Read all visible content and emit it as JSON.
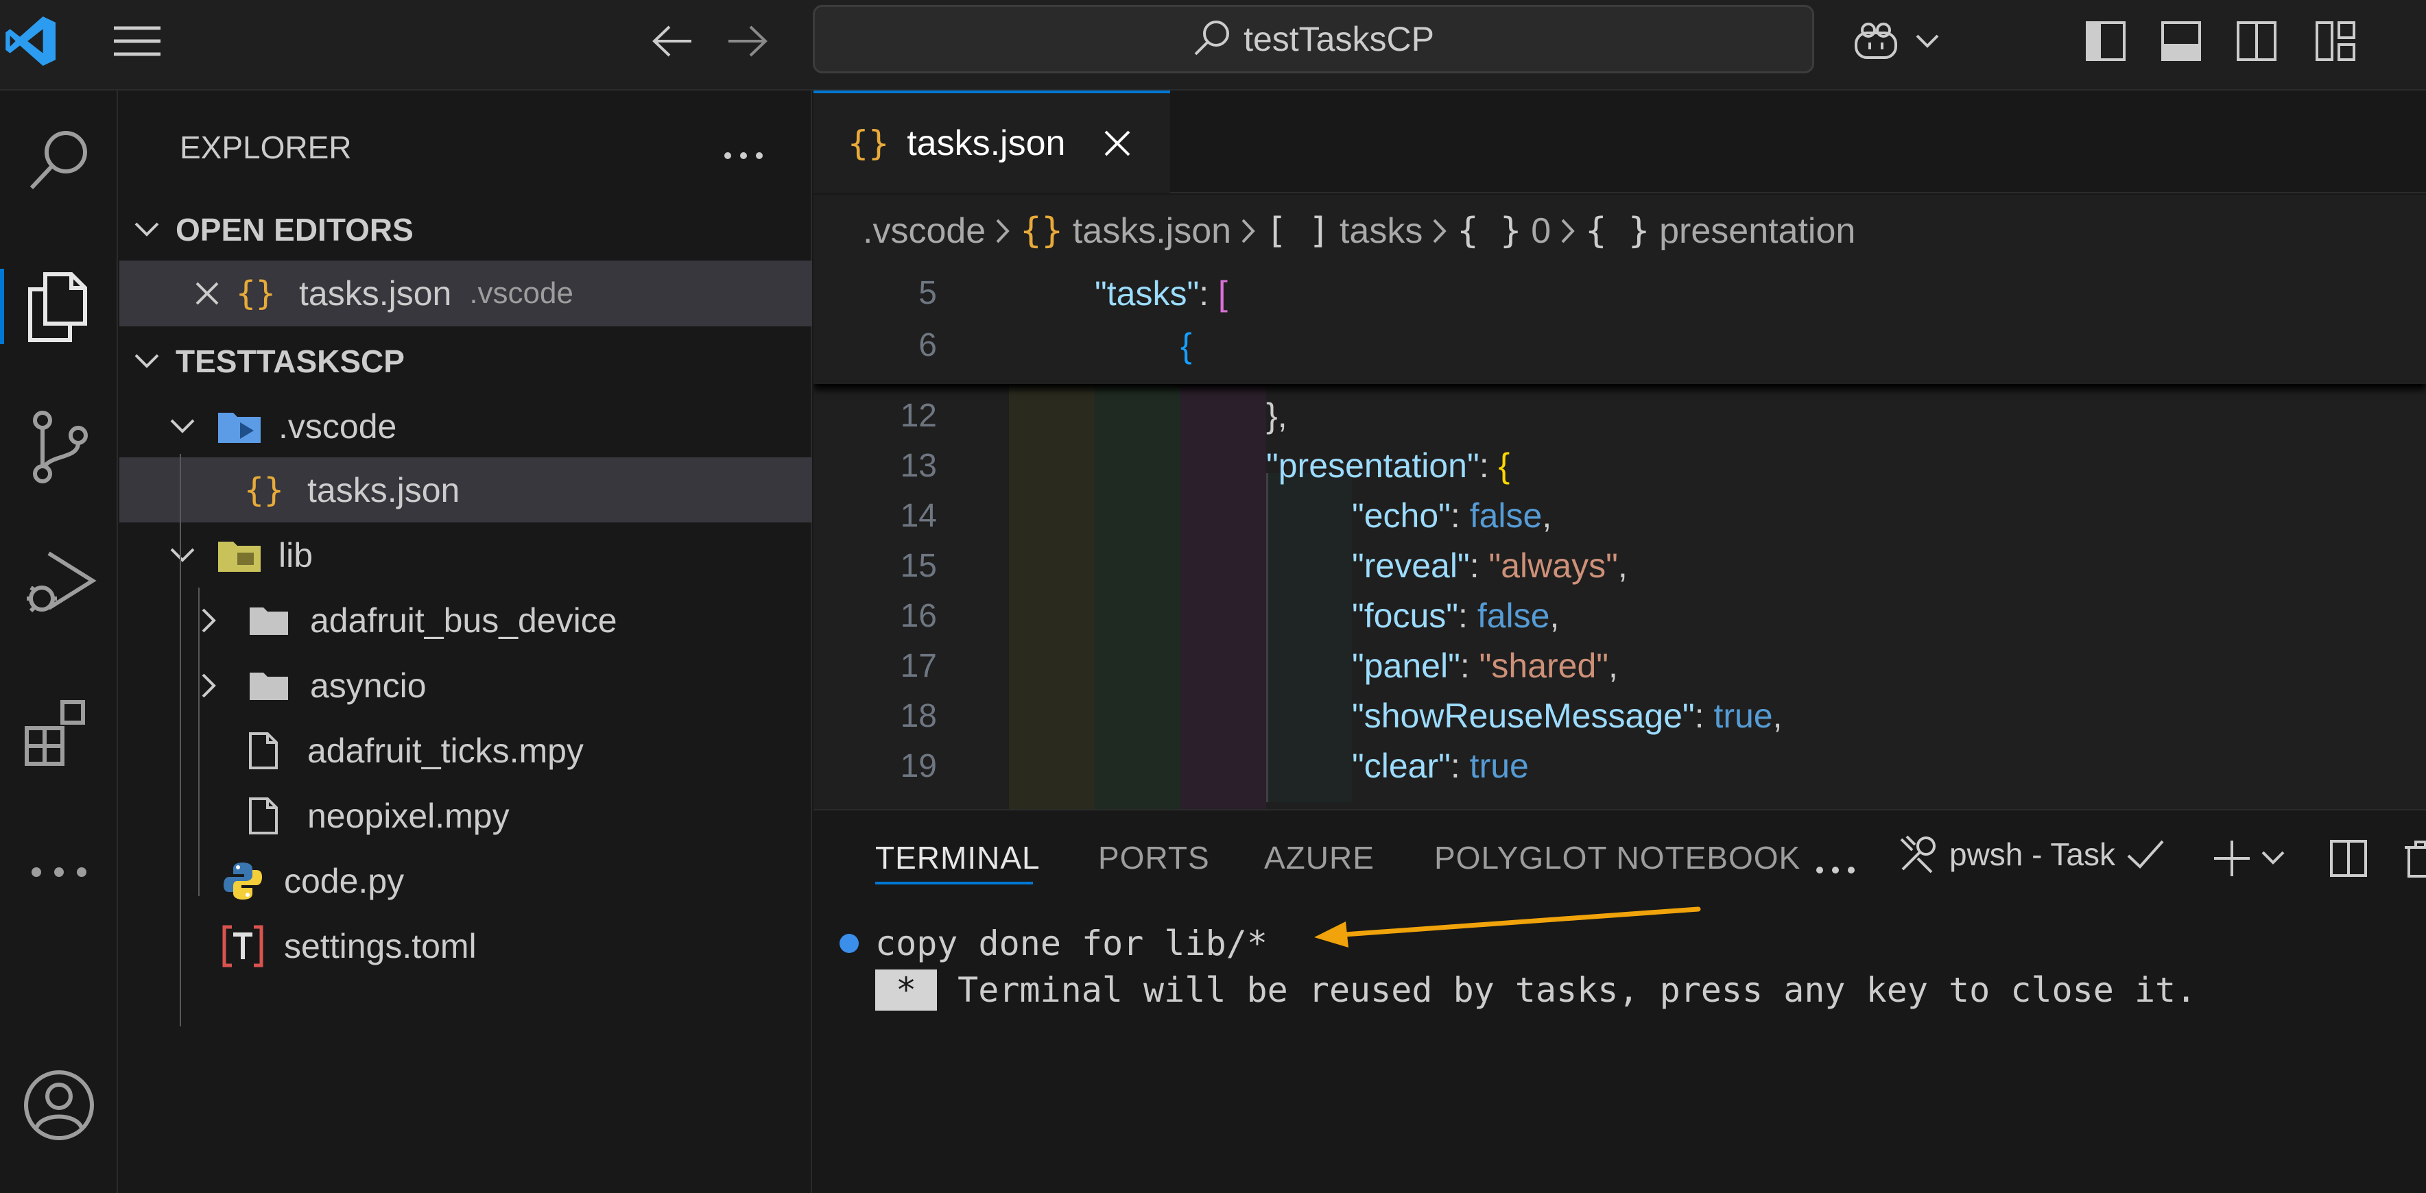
{
  "titlebar": {
    "search_text": "testTasksCP",
    "icons": [
      "vscode-logo-icon",
      "menu-icon",
      "back-arrow-icon",
      "forward-arrow-icon",
      "search-icon",
      "copilot-icon",
      "chevron-down-icon",
      "toggle-primary-sidebar-icon",
      "toggle-panel-icon",
      "toggle-secondary-sidebar-icon",
      "customize-layout-icon"
    ]
  },
  "activitybar": {
    "items": [
      "search-icon",
      "explorer-icon",
      "source-control-icon",
      "run-debug-icon",
      "extensions-icon",
      "more-icon",
      "account-icon"
    ]
  },
  "sidebar": {
    "title": "EXPLORER",
    "open_editors_label": "OPEN EDITORS",
    "open_editor": {
      "name": "tasks.json",
      "folder": ".vscode"
    },
    "workspace_label": "TESTTASKSCP",
    "tree": [
      {
        "name": ".vscode",
        "kind": "folder-vscode"
      },
      {
        "name": "tasks.json",
        "kind": "json"
      },
      {
        "name": "lib",
        "kind": "folder-lib"
      },
      {
        "name": "adafruit_bus_device",
        "kind": "folder"
      },
      {
        "name": "asyncio",
        "kind": "folder"
      },
      {
        "name": "adafruit_ticks.mpy",
        "kind": "file"
      },
      {
        "name": "neopixel.mpy",
        "kind": "file"
      },
      {
        "name": "code.py",
        "kind": "python"
      },
      {
        "name": "settings.toml",
        "kind": "toml"
      }
    ]
  },
  "editor": {
    "tab_label": "tasks.json",
    "breadcrumb": [
      ".vscode",
      "tasks.json",
      "tasks",
      "0",
      "presentation"
    ],
    "breadcrumb_glyphs": [
      "{ }",
      "[ ]",
      "{ }",
      "{ }"
    ],
    "sticky_lines": [
      {
        "num": "5",
        "key": "\"tasks\"",
        "rest": ": ",
        "open": "["
      },
      {
        "num": "6",
        "open": "{"
      }
    ],
    "lines": [
      {
        "num": "12",
        "text": "},"
      },
      {
        "num": "13",
        "key": "\"presentation\"",
        "open": "{"
      },
      {
        "num": "14",
        "key": "\"echo\"",
        "val": "false",
        "vtype": "b"
      },
      {
        "num": "15",
        "key": "\"reveal\"",
        "val": "\"always\"",
        "vtype": "s"
      },
      {
        "num": "16",
        "key": "\"focus\"",
        "val": "false",
        "vtype": "b"
      },
      {
        "num": "17",
        "key": "\"panel\"",
        "val": "\"shared\"",
        "vtype": "s"
      },
      {
        "num": "18",
        "key": "\"showReuseMessage\"",
        "val": "true",
        "vtype": "b"
      },
      {
        "num": "19",
        "key": "\"clear\"",
        "val": "true",
        "vtype": "b",
        "last": true
      }
    ]
  },
  "panel": {
    "tabs": [
      "TERMINAL",
      "PORTS",
      "AZURE",
      "POLYGLOT NOTEBOOK"
    ],
    "terminal_name": "pwsh - Task",
    "line1": "copy done for lib/*",
    "line2_badge": "*",
    "line2": "Terminal will be reused by tasks, press any key to close it.",
    "arrow_color": "#f0a30a"
  },
  "colors": {
    "accent": "#0078d4",
    "json_icon": "#e8ab3a"
  }
}
